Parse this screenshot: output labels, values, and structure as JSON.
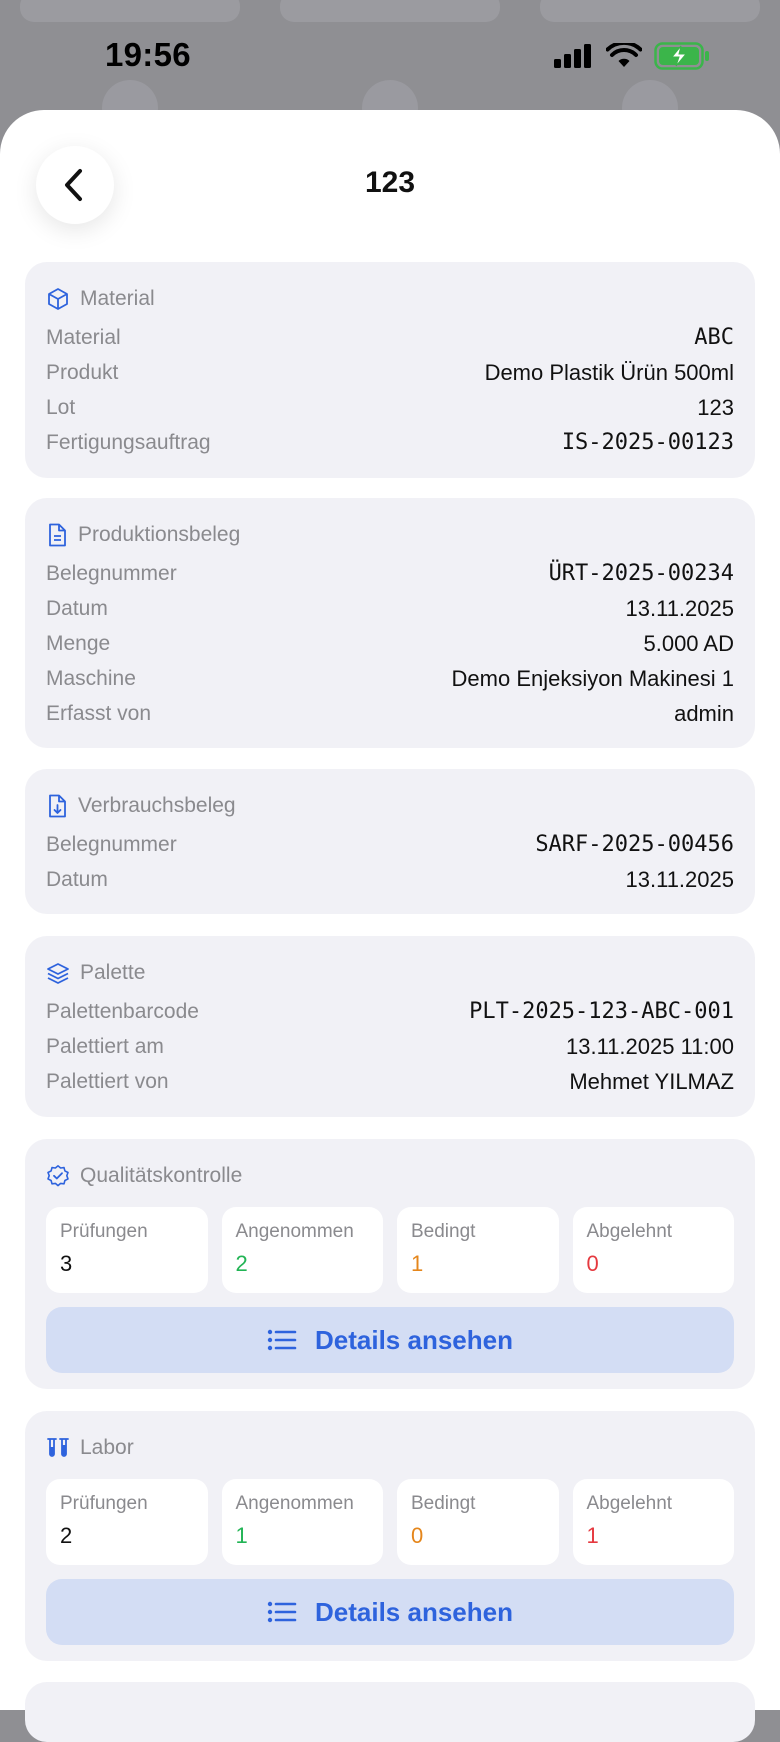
{
  "status": {
    "time": "19:56"
  },
  "header": {
    "title": "123"
  },
  "material": {
    "title": "Material",
    "rows": [
      {
        "label": "Material",
        "value": "ABC"
      },
      {
        "label": "Produkt",
        "value": "Demo Plastik Ürün 500ml"
      },
      {
        "label": "Lot",
        "value": "123"
      },
      {
        "label": "Fertigungsauftrag",
        "value": "IS-2025-00123"
      }
    ]
  },
  "production": {
    "title": "Produktionsbeleg",
    "rows": [
      {
        "label": "Belegnummer",
        "value": "ÜRT-2025-00234"
      },
      {
        "label": "Datum",
        "value": "13.11.2025"
      },
      {
        "label": "Menge",
        "value": "5.000 AD"
      },
      {
        "label": "Maschine",
        "value": "Demo Enjeksiyon Makinesi 1"
      },
      {
        "label": "Erfasst von",
        "value": "admin"
      }
    ]
  },
  "consumption": {
    "title": "Verbrauchsbeleg",
    "rows": [
      {
        "label": "Belegnummer",
        "value": "SARF-2025-00456"
      },
      {
        "label": "Datum",
        "value": "13.11.2025"
      }
    ]
  },
  "pallet": {
    "title": "Palette",
    "rows": [
      {
        "label": "Palettenbarcode",
        "value": "PLT-2025-123-ABC-001"
      },
      {
        "label": "Palettiert am",
        "value": "13.11.2025 11:00"
      },
      {
        "label": "Palettiert von",
        "value": "Mehmet YILMAZ"
      }
    ]
  },
  "quality": {
    "title": "Qualitätskontrolle",
    "stats": [
      {
        "label": "Prüfungen",
        "value": "3"
      },
      {
        "label": "Angenommen",
        "value": "2"
      },
      {
        "label": "Bedingt",
        "value": "1"
      },
      {
        "label": "Abgelehnt",
        "value": "0"
      }
    ],
    "button": "Details ansehen"
  },
  "lab": {
    "title": "Labor",
    "stats": [
      {
        "label": "Prüfungen",
        "value": "2"
      },
      {
        "label": "Angenommen",
        "value": "1"
      },
      {
        "label": "Bedingt",
        "value": "0"
      },
      {
        "label": "Abgelehnt",
        "value": "1"
      }
    ],
    "button": "Details ansehen"
  },
  "colors": {
    "accent": "#2e63dd",
    "green": "#22b455",
    "orange": "#e5861b",
    "red": "#e5393f",
    "neutral": "#111111"
  }
}
